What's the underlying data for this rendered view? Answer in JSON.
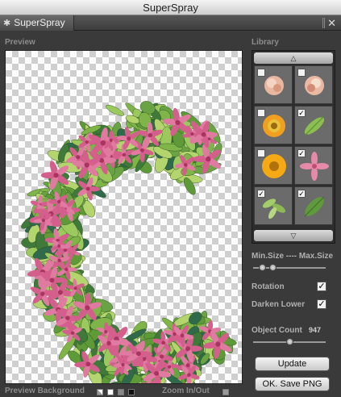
{
  "window": {
    "title": "SuperSpray"
  },
  "panel": {
    "tab_label": "SuperSpray",
    "close_glyph": "✕"
  },
  "preview": {
    "label": "Preview"
  },
  "bottom_bar": {
    "bg_label": "Preview Background",
    "zoom_label": "Zoom In/Out"
  },
  "library": {
    "label": "Library",
    "up_glyph": "△",
    "down_glyph": "▽",
    "items": [
      {
        "icon": "pink-rose-icon",
        "checked": false
      },
      {
        "icon": "pink-rose-icon",
        "checked": false
      },
      {
        "icon": "orange-daisy-icon",
        "checked": false
      },
      {
        "icon": "green-leaf-icon",
        "checked": true
      },
      {
        "icon": "orange-daisy-icon",
        "checked": false
      },
      {
        "icon": "pink-lily-icon",
        "checked": true
      },
      {
        "icon": "leaf-cluster-icon",
        "checked": true
      },
      {
        "icon": "green-leaf-icon",
        "checked": true
      }
    ]
  },
  "controls": {
    "size_label": "Min.Size ---- Max.Size",
    "rotation_label": "Rotation",
    "rotation_checked": true,
    "darken_label": "Darken Lower",
    "darken_checked": true,
    "count_label": "Object Count",
    "count_value": "947",
    "check_glyph": "✓"
  },
  "buttons": {
    "update": "Update",
    "save": "OK. Save PNG"
  }
}
